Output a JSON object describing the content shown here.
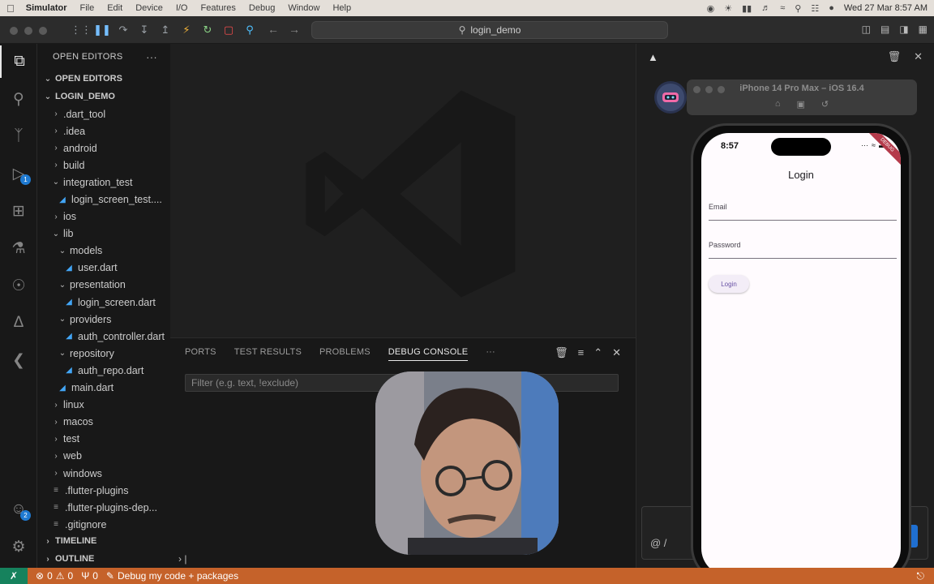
{
  "menubar": {
    "app": "Simulator",
    "items": [
      "File",
      "Edit",
      "Device",
      "I/O",
      "Features",
      "Debug",
      "Window",
      "Help"
    ],
    "clock": "Wed 27 Mar  8:57 AM"
  },
  "titlebar": {
    "search": "login_demo"
  },
  "explorer": {
    "header": "OPEN EDITORS",
    "open_editors": "OPEN EDITORS",
    "project": "LOGIN_DEMO",
    "items": [
      {
        "label": ".dart_tool",
        "kind": "folder"
      },
      {
        "label": ".idea",
        "kind": "folder"
      },
      {
        "label": "android",
        "kind": "folder"
      },
      {
        "label": "build",
        "kind": "folder"
      },
      {
        "label": "integration_test",
        "kind": "folder-open"
      },
      {
        "label": "login_screen_test....",
        "kind": "dart"
      },
      {
        "label": "ios",
        "kind": "folder"
      },
      {
        "label": "lib",
        "kind": "folder-open"
      },
      {
        "label": "models",
        "kind": "folder-open"
      },
      {
        "label": "user.dart",
        "kind": "dart"
      },
      {
        "label": "presentation",
        "kind": "folder-open"
      },
      {
        "label": "login_screen.dart",
        "kind": "dart"
      },
      {
        "label": "providers",
        "kind": "folder-open"
      },
      {
        "label": "auth_controller.dart",
        "kind": "dart"
      },
      {
        "label": "repository",
        "kind": "folder-open"
      },
      {
        "label": "auth_repo.dart",
        "kind": "dart"
      },
      {
        "label": "main.dart",
        "kind": "dart"
      },
      {
        "label": "linux",
        "kind": "folder"
      },
      {
        "label": "macos",
        "kind": "folder"
      },
      {
        "label": "test",
        "kind": "folder"
      },
      {
        "label": "web",
        "kind": "folder"
      },
      {
        "label": "windows",
        "kind": "folder"
      },
      {
        "label": ".flutter-plugins",
        "kind": "file"
      },
      {
        "label": ".flutter-plugins-dep...",
        "kind": "file"
      },
      {
        "label": ".gitignore",
        "kind": "file"
      }
    ],
    "timeline": "TIMELINE",
    "outline": "OUTLINE"
  },
  "activity_badges": {
    "debug": "1",
    "accounts": "2"
  },
  "panel": {
    "tabs": [
      "PORTS",
      "TEST RESULTS",
      "PROBLEMS",
      "DEBUG CONSOLE"
    ],
    "active_tab": "DEBUG CONSOLE",
    "more": "···",
    "filter_placeholder": "Filter (e.g. text, !exclude)"
  },
  "simulator": {
    "title": "iPhone 14 Pro Max – iOS 16.4",
    "time": "8:57",
    "ribbon": "DEBUG",
    "app_title": "Login",
    "email_label": "Email",
    "password_label": "Password",
    "login_button": "Login"
  },
  "statusbar": {
    "errors": "0",
    "warnings": "0",
    "ports": "0",
    "debug_label": "Debug my code + packages"
  },
  "colors": {
    "statusbar": "#c5622a",
    "accent": "#1f7ad1",
    "material_primary": "#6750a4"
  }
}
